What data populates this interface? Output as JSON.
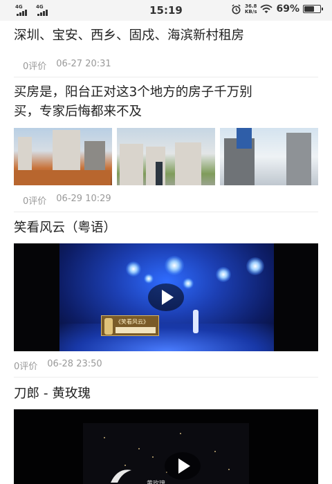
{
  "status_bar": {
    "network1": "4G",
    "network2": "4G",
    "time": "15:19",
    "speed_value": "36.8",
    "speed_unit": "KB/s",
    "battery_percent": "69%",
    "battery_level": 0.69
  },
  "feed": [
    {
      "title": "深圳、宝安、西乡、固戍、海滨新村租房",
      "comments": "0评价",
      "date": "06-27 20:31"
    },
    {
      "title_line1": "买房是，阳台正对这3个地方的房子千万别",
      "title_line2": "买，专家后悔都来不及",
      "comments": "0评价",
      "date": "06-29 10:29"
    },
    {
      "title": "笑看风云（粤语）",
      "comments": "0评价",
      "date": "06-28 23:50",
      "video_caption": "《笑看风云》"
    },
    {
      "title": "刀郎 - 黄玫瑰",
      "video_caption": "黄玫瑰"
    }
  ],
  "colors": {
    "text": "#222222",
    "meta": "#999999",
    "divider": "#ececec",
    "status_bg": "#f4f4f4"
  }
}
